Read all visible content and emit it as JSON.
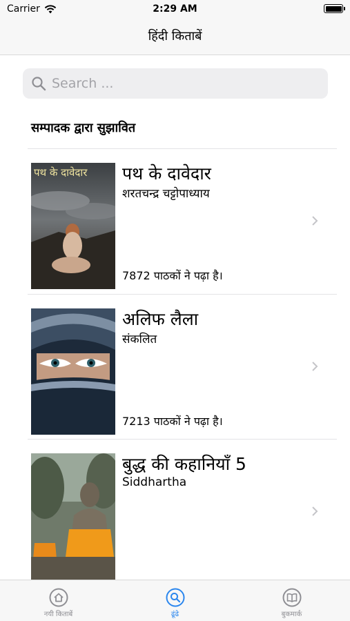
{
  "status_bar": {
    "carrier": "Carrier",
    "time": "2:29 AM"
  },
  "nav": {
    "title": "हिंदी किताबें"
  },
  "search": {
    "placeholder": "Search ..."
  },
  "section": {
    "title": "सम्पादक द्वारा सुझावित"
  },
  "books": [
    {
      "title": "पथ के दावेदार",
      "author": "शरतचन्द्र चट्टोपाध्याय",
      "readers": "7872 पाठकों ने पढ़ा है।",
      "cover_text": "पथ के दावेदार"
    },
    {
      "title": "अलिफ लैला",
      "author": "संकलित",
      "readers": "7213 पाठकों ने पढ़ा है।"
    },
    {
      "title": "बुद्ध की कहानियाँ 5",
      "author": "Siddhartha",
      "readers": ""
    }
  ],
  "tabs": [
    {
      "label": "नयी किताबें",
      "icon": "house-icon"
    },
    {
      "label": "ढूंढे",
      "icon": "search-icon"
    },
    {
      "label": "बुकमार्क",
      "icon": "book-icon"
    }
  ],
  "colors": {
    "accent": "#2a86ee",
    "inactive": "#8e8e93",
    "bar_bg": "#f7f7f7"
  }
}
